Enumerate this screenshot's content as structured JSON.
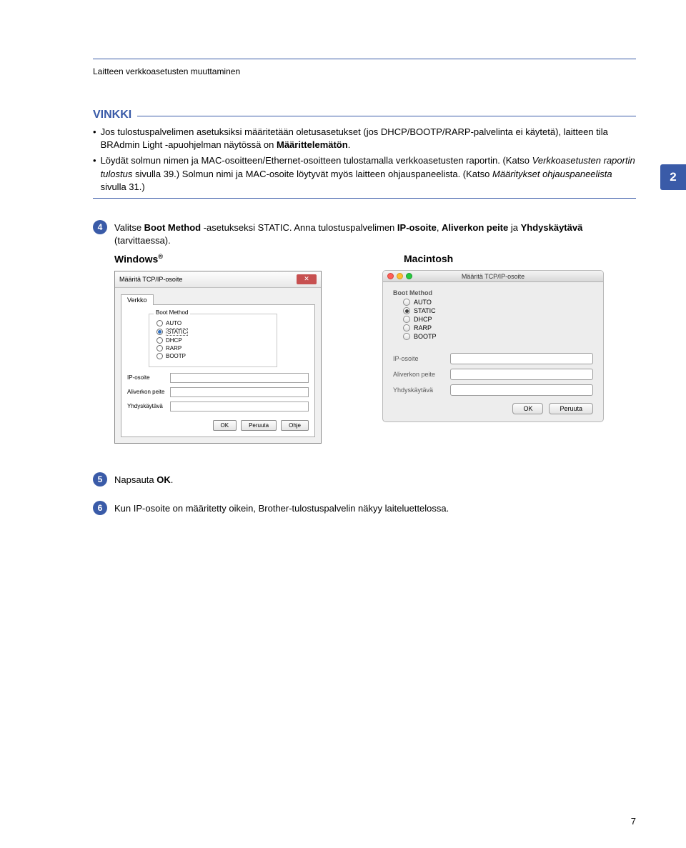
{
  "header_section": "Laitteen verkkoasetusten muuttaminen",
  "side_tab": "2",
  "page_number": "7",
  "vinkki": {
    "title": "VINKKI",
    "bullet1": "Jos tulostuspalvelimen asetuksiksi määritetään oletusasetukset (jos DHCP/BOOTP/RARP-palvelinta ei käytetä), laitteen tila BRAdmin Light -apuohjelman näytössä on ",
    "bullet1_bold": "Määrittelemätön",
    "bullet1_end": ".",
    "bullet2a": "Löydät solmun nimen ja MAC-osoitteen/Ethernet-osoitteen tulostamalla verkkoasetusten raportin. (Katso ",
    "bullet2b": "Verkkoasetusten raportin tulostus",
    "bullet2c": " sivulla 39.) Solmun nimi ja MAC-osoite löytyvät myös laitteen ohjauspaneelista. (Katso ",
    "bullet2d": "Määritykset ohjauspaneelista",
    "bullet2e": " sivulla 31.)"
  },
  "step4": {
    "num": "4",
    "a": "Valitse ",
    "b": "Boot Method",
    "c": " -asetukseksi STATIC. Anna tulostuspalvelimen ",
    "d": "IP-osoite",
    "e": ", ",
    "f": "Aliverkon peite",
    "g": " ja ",
    "h": "Yhdyskäytävä",
    "i": " (tarvittaessa)."
  },
  "step5": {
    "num": "5",
    "a": "Napsauta ",
    "b": "OK",
    "c": "."
  },
  "step6": {
    "num": "6",
    "text": "Kun IP-osoite on määritetty oikein, Brother-tulostuspalvelin näkyy laiteluettelossa."
  },
  "os": {
    "win": "Windows",
    "mac": "Macintosh"
  },
  "win_dialog": {
    "title": "Määritä TCP/IP-osoite",
    "tab": "Verkko",
    "group": "Boot Method",
    "r1": "AUTO",
    "r2": "STATIC",
    "r3": "DHCP",
    "r4": "RARP",
    "r5": "BOOTP",
    "f1": "IP-osoite",
    "f2": "Aliverkon peite",
    "f3": "Yhdyskäytävä",
    "ok": "OK",
    "cancel": "Peruuta",
    "help": "Ohje"
  },
  "mac_dialog": {
    "title": "Määritä TCP/IP-osoite",
    "group": "Boot Method",
    "r1": "AUTO",
    "r2": "STATIC",
    "r3": "DHCP",
    "r4": "RARP",
    "r5": "BOOTP",
    "f1": "IP-osoite",
    "f2": "Aliverkon peite",
    "f3": "Yhdyskäytävä",
    "ok": "OK",
    "cancel": "Peruuta"
  }
}
